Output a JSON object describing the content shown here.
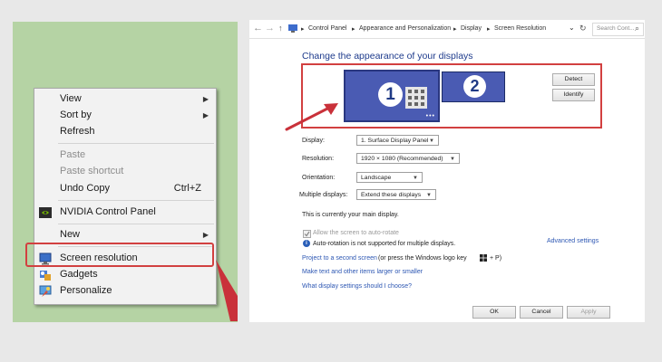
{
  "context_menu": {
    "items": [
      {
        "label": "View",
        "shortcut": "",
        "submenu": true
      },
      {
        "label": "Sort by",
        "shortcut": "",
        "submenu": true
      },
      {
        "label": "Refresh",
        "shortcut": "",
        "submenu": false
      },
      {
        "label": "Paste",
        "shortcut": "",
        "submenu": false
      },
      {
        "label": "Paste shortcut",
        "shortcut": "",
        "submenu": false
      },
      {
        "label": "Undo Copy",
        "shortcut": "Ctrl+Z",
        "submenu": false
      },
      {
        "label": "NVIDIA Control Panel",
        "shortcut": "",
        "submenu": false
      },
      {
        "label": "New",
        "shortcut": "",
        "submenu": true
      },
      {
        "label": "Screen resolution",
        "shortcut": "",
        "submenu": false
      },
      {
        "label": "Gadgets",
        "shortcut": "",
        "submenu": false
      },
      {
        "label": "Personalize",
        "shortcut": "",
        "submenu": false
      }
    ],
    "submenu_glyph": "▶"
  },
  "window": {
    "address": {
      "back": "←",
      "forward": "→",
      "up": "↑",
      "crumb1": "Control Panel",
      "crumb2": "Appearance and Personalization",
      "crumb3": "Display",
      "crumb4": "Screen Resolution",
      "sep": "▸",
      "dropdown": "⌄",
      "refresh": "↻",
      "search_placeholder": "Search Cont...",
      "search_icon": "⌕"
    },
    "title": "Change the appearance of your displays",
    "monitors": {
      "m1": "1",
      "m2": "2"
    },
    "detect": "Detect",
    "identify": "Identify",
    "fields": {
      "display_label": "Display:",
      "display_value": "1. Surface Display Panel",
      "resolution_label": "Resolution:",
      "resolution_value": "1920 × 1080 (Recommended)",
      "orientation_label": "Orientation:",
      "orientation_value": "Landscape",
      "multiple_label": "Multiple displays:",
      "multiple_value": "Extend these displays",
      "arrow": "▼"
    },
    "main_display_text": "This is currently your main display.",
    "auto_rotate": "Allow the screen to auto-rotate",
    "auto_rotate_info": "Auto-rotation is not supported for multiple displays.",
    "advanced": "Advanced settings",
    "links": {
      "project": "Project to a second screen",
      "project_suffix": " (or press the Windows logo key",
      "project_end": "+ P)",
      "larger": "Make text and other items larger or smaller",
      "which": "What display settings should I choose?"
    },
    "buttons": {
      "ok": "OK",
      "cancel": "Cancel",
      "apply": "Apply"
    }
  },
  "colors": {
    "highlight": "#d24040",
    "monitor": "#4a5bb3",
    "link": "#2d57b3"
  }
}
